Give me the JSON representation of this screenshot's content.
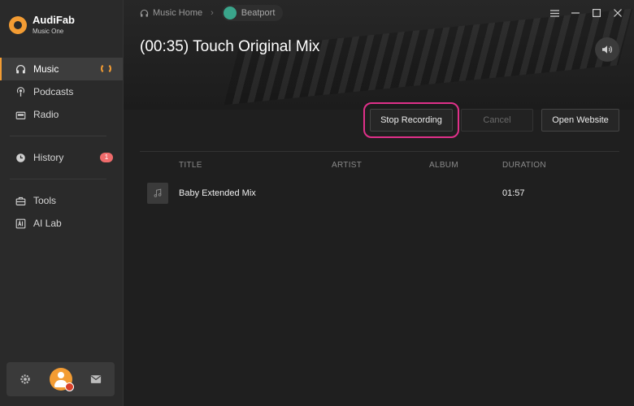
{
  "brand": {
    "name": "AudiFab",
    "subtitle": "Music One"
  },
  "sidebar": {
    "items": [
      {
        "label": "Music",
        "icon": "headphones-icon"
      },
      {
        "label": "Podcasts",
        "icon": "podcast-icon"
      },
      {
        "label": "Radio",
        "icon": "radio-icon"
      },
      {
        "label": "History",
        "icon": "clock-icon",
        "badge": "1"
      },
      {
        "label": "Tools",
        "icon": "toolbox-icon"
      },
      {
        "label": "AI Lab",
        "icon": "ai-icon"
      }
    ]
  },
  "breadcrumb": {
    "home": "Music Home",
    "current": "Beatport"
  },
  "page": {
    "title": "(00:35) Touch Original Mix"
  },
  "actions": {
    "stop": "Stop Recording",
    "cancel": "Cancel",
    "open": "Open Website"
  },
  "table": {
    "headers": {
      "title": "TITLE",
      "artist": "ARTIST",
      "album": "ALBUM",
      "duration": "DURATION"
    },
    "rows": [
      {
        "title": "Baby Extended Mix",
        "artist": "",
        "album": "",
        "duration": "01:57"
      }
    ]
  },
  "colors": {
    "accent": "#f39c33",
    "highlight": "#e0308a",
    "badge": "#ef6b6b",
    "beatport": "#3aa58b"
  }
}
